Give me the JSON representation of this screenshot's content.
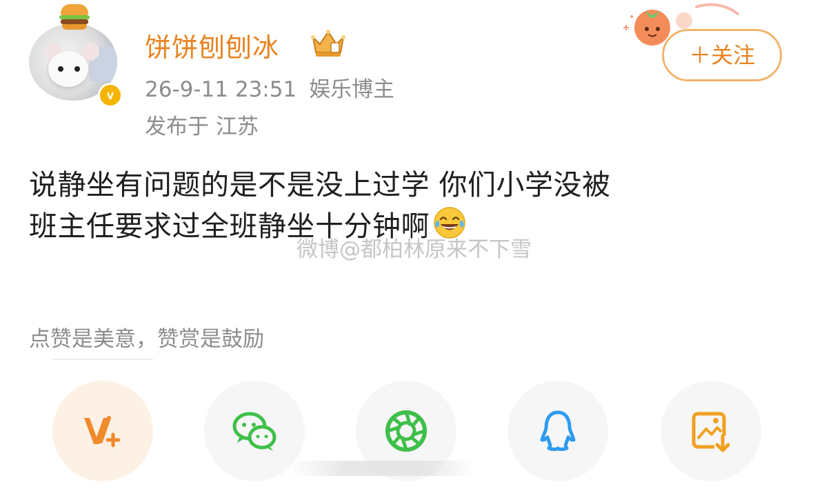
{
  "author": {
    "name": "饼饼刨刨冰",
    "timestamp": "26-9-11 23:51",
    "tag": "娱乐博主",
    "location": "发布于 江苏",
    "verified_symbol": "v"
  },
  "header": {
    "follow_label": "＋关注"
  },
  "post": {
    "lines": [
      "说静坐有问题的是不是没上过学 你们小学没被",
      "班主任要求过全班静坐十分钟啊"
    ],
    "emoji": "laugh-cry-emoji"
  },
  "watermark": "微博@都柏林原来不下雪",
  "reward": {
    "text": "点赞是美意，赞赏是鼓励"
  },
  "share": {
    "items": [
      {
        "icon": "v-plus-icon"
      },
      {
        "icon": "wechat-icon"
      },
      {
        "icon": "moments-icon"
      },
      {
        "icon": "qq-icon"
      },
      {
        "icon": "save-image-icon"
      }
    ]
  },
  "colors": {
    "accent": "#e8821f",
    "meta_text": "#8c8c8c",
    "body_text": "#1f1f1f",
    "wechat_green": "#3fbf4a",
    "qq_blue": "#2e9bf0",
    "save_orange": "#f0a020"
  }
}
